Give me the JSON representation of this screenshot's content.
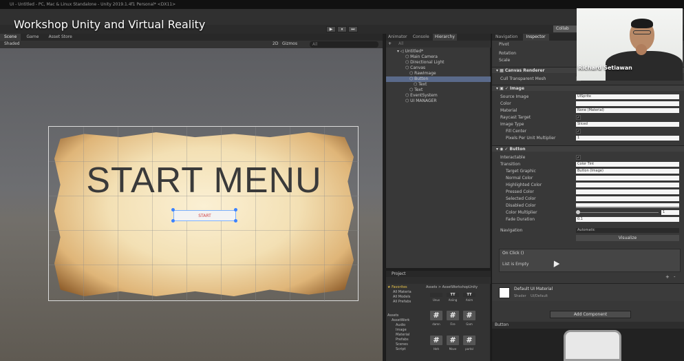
{
  "window": {
    "title": "UI - Untitled - PC, Mac & Linux Standalone - Unity 2019.1.4f1 Personal* <DX11>"
  },
  "overlay": {
    "video_title": "Workshop Unity and Virtual Reality",
    "speaker_name": "Richard Setiawan"
  },
  "toolbar": {
    "play": "▶",
    "pause": "⏸",
    "step": "⏭",
    "collab": "Collab"
  },
  "scene": {
    "tabs": [
      "Scene",
      "Game",
      "Asset Store"
    ],
    "shading_mode": "Shaded",
    "mode_2d": "2D",
    "gizmos": "Gizmos",
    "search_placeholder": "All",
    "menu_title": "START MENU",
    "button_text": "START"
  },
  "hierarchy": {
    "tabs": [
      "Animator",
      "Console",
      "Hierarchy"
    ],
    "create": "+",
    "search_placeholder": "All",
    "items": [
      {
        "label": "Untitled*",
        "indent": 0,
        "selected": false
      },
      {
        "label": "Main Camera",
        "indent": 2,
        "selected": false
      },
      {
        "label": "Directional Light",
        "indent": 2,
        "selected": false
      },
      {
        "label": "Canvas",
        "indent": 2,
        "selected": false
      },
      {
        "label": "RawImage",
        "indent": 3,
        "selected": false
      },
      {
        "label": "Button",
        "indent": 3,
        "selected": true
      },
      {
        "label": "Text",
        "indent": 4,
        "selected": false
      },
      {
        "label": "Text",
        "indent": 3,
        "selected": false
      },
      {
        "label": "EventSystem",
        "indent": 2,
        "selected": false
      },
      {
        "label": "UI MANAGER",
        "indent": 2,
        "selected": false
      }
    ]
  },
  "project": {
    "tab": "Project",
    "favorites": "Favorites",
    "favorite_items": [
      "All Materia",
      "All Models",
      "All Prefabs"
    ],
    "assets": "Assets",
    "asset_tree": [
      "AssetWork",
      "Audio",
      "Image",
      "Material",
      "Prefabs",
      "Scenes",
      "Script"
    ],
    "breadcrumb": "Assets > AssetWorkshopUnity",
    "thumbs_row1": [
      "Unus",
      "Aniing",
      "Anim"
    ],
    "thumbs_row2": [
      "#",
      "#",
      "#"
    ],
    "thumbs_row2_labels": [
      "damn",
      "Fire",
      "Gam"
    ],
    "thumbs_row3": [
      "#",
      "#",
      "#"
    ],
    "thumbs_row3_labels": [
      "Heh",
      "Move",
      "portal"
    ]
  },
  "inspector": {
    "tabs": [
      "Navigation",
      "Inspector"
    ],
    "transform_rows": [
      "Pivot",
      "Rotation",
      "Scale"
    ],
    "canvas_renderer": {
      "header": "Canvas Renderer",
      "cull_label": "Cull Transparent Mesh"
    },
    "image": {
      "header": "Image",
      "source_label": "Source Image",
      "source_value": "UISprite",
      "color_label": "Color",
      "material_label": "Material",
      "material_value": "None (Material)",
      "raycast_label": "Raycast Target",
      "type_label": "Image Type",
      "type_value": "Sliced",
      "fill_label": "Fill Center",
      "ppu_label": "Pixels Per Unit Multiplier",
      "ppu_value": "1"
    },
    "button": {
      "header": "Button",
      "interactable_label": "Interactable",
      "transition_label": "Transition",
      "transition_value": "Color Tint",
      "target_label": "Target Graphic",
      "target_value": "Button (Image)",
      "normal_label": "Normal Color",
      "highlighted_label": "Highlighted Color",
      "pressed_label": "Pressed Color",
      "selected_label": "Selected Color",
      "disabled_label": "Disabled Color",
      "multiplier_label": "Color Multiplier",
      "multiplier_value": "1",
      "multiplier_level": 0.0,
      "fade_label": "Fade Duration",
      "fade_value": "0.1"
    },
    "navigation_label": "Navigation",
    "navigation_value": "Automatic",
    "visualize": "Visualize",
    "on_click": "On Click ()",
    "list_empty": "List is Empty",
    "add_remove": [
      "+",
      "-"
    ],
    "material_name": "Default UI Material",
    "shader_label": "Shader",
    "shader_value": "UI/Default",
    "add_component": "Add Component",
    "preview_label": "Button"
  },
  "colors": {
    "editor_bg": "#383838",
    "selection": "#5a6a8a",
    "handle": "#3b82ff",
    "start_text": "#d04040"
  }
}
